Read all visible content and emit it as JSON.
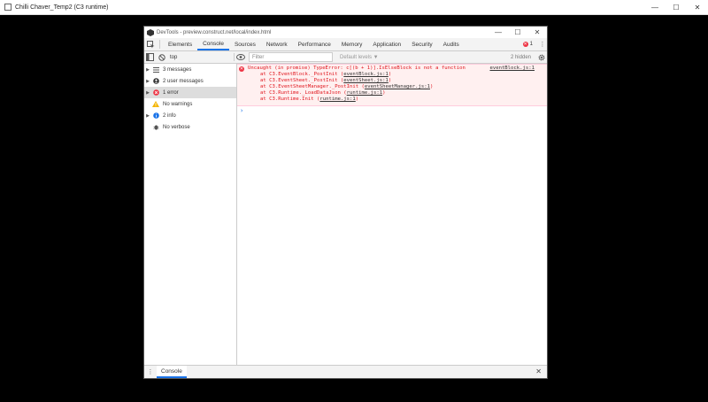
{
  "window": {
    "title": "Chilli Chaver_Temp2 (C3 runtime)",
    "controls": [
      "—",
      "☐",
      "✕"
    ]
  },
  "devtools": {
    "title": "DevTools - preview.construct.net/local/index.html",
    "controls": [
      "—",
      "☐",
      "✕"
    ],
    "tabs": [
      {
        "label": "Elements",
        "active": false
      },
      {
        "label": "Console",
        "active": true
      },
      {
        "label": "Sources",
        "active": false
      },
      {
        "label": "Network",
        "active": false
      },
      {
        "label": "Performance",
        "active": false
      },
      {
        "label": "Memory",
        "active": false
      },
      {
        "label": "Application",
        "active": false
      },
      {
        "label": "Security",
        "active": false
      },
      {
        "label": "Audits",
        "active": false
      }
    ],
    "error_count": "1",
    "toolbar": {
      "context": "top",
      "filter_placeholder": "Filter",
      "levels": "Default levels ▼",
      "hidden": "2 hidden"
    },
    "sidebar": [
      {
        "label": "3 messages",
        "icon": "list-icon",
        "arrow": true,
        "selected": false
      },
      {
        "label": "2 user messages",
        "icon": "user-icon",
        "arrow": true,
        "selected": false
      },
      {
        "label": "1 error",
        "icon": "error-icon",
        "arrow": true,
        "selected": true
      },
      {
        "label": "No warnings",
        "icon": "warning-icon",
        "arrow": false,
        "selected": false
      },
      {
        "label": "2 info",
        "icon": "info-icon",
        "arrow": true,
        "selected": false
      },
      {
        "label": "No verbose",
        "icon": "bug-icon",
        "arrow": false,
        "selected": false
      }
    ],
    "console": {
      "error_message": "Uncaught (in promise) TypeError: c[(b + 1)].IsElseBlock is not a function",
      "source_link": "eventBlock.js:1",
      "stack": [
        {
          "text": "at C3.EventBlock._PostInit (",
          "link": "eventBlock.js:1",
          "end": ")"
        },
        {
          "text": "at C3.EventSheet._PostInit (",
          "link": "eventSheet.js:1",
          "end": ")"
        },
        {
          "text": "at C3.EventSheetManager._PostInit (",
          "link": "eventSheetManager.js:1",
          "end": ")"
        },
        {
          "text": "at C3.Runtime._LoadDataJson (",
          "link": "runtime.js:1",
          "end": ")"
        },
        {
          "text": "at C3.Runtime.Init (",
          "link": "runtime.js:1",
          "end": ")"
        }
      ],
      "prompt": "›"
    },
    "drawer": {
      "tab": "Console",
      "close": "✕"
    }
  }
}
